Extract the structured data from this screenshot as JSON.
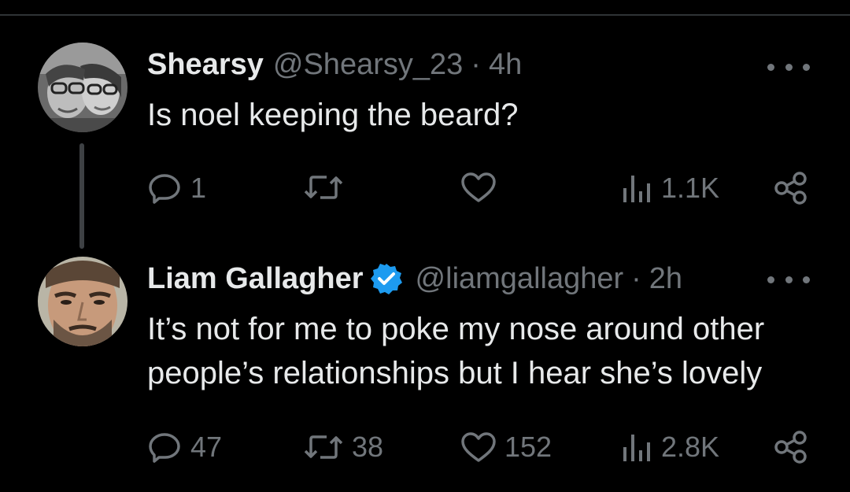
{
  "tweets": [
    {
      "display_name": "Shearsy",
      "handle": "@Shearsy_23",
      "separator": "·",
      "time": "4h",
      "text": "Is noel keeping the beard?",
      "verified": false,
      "actions": {
        "replies": "1",
        "retweets": "",
        "likes": "",
        "views": "1.1K"
      }
    },
    {
      "display_name": "Liam Gallagher",
      "handle": "@liamgallagher",
      "separator": "·",
      "time": "2h",
      "text": "It’s not for me to poke my nose around other people’s relationships but I hear she’s lovely",
      "verified": true,
      "actions": {
        "replies": "47",
        "retweets": "38",
        "likes": "152",
        "views": "2.8K"
      }
    }
  ],
  "colors": {
    "background": "#000000",
    "primary_text": "#e7e9ea",
    "secondary_text": "#71767b",
    "verified_badge": "#1d9bf0",
    "thread_line": "#3e4144"
  },
  "icons": [
    "reply-icon",
    "retweet-icon",
    "like-icon",
    "views-icon",
    "share-icon",
    "more-icon",
    "verified-icon"
  ]
}
